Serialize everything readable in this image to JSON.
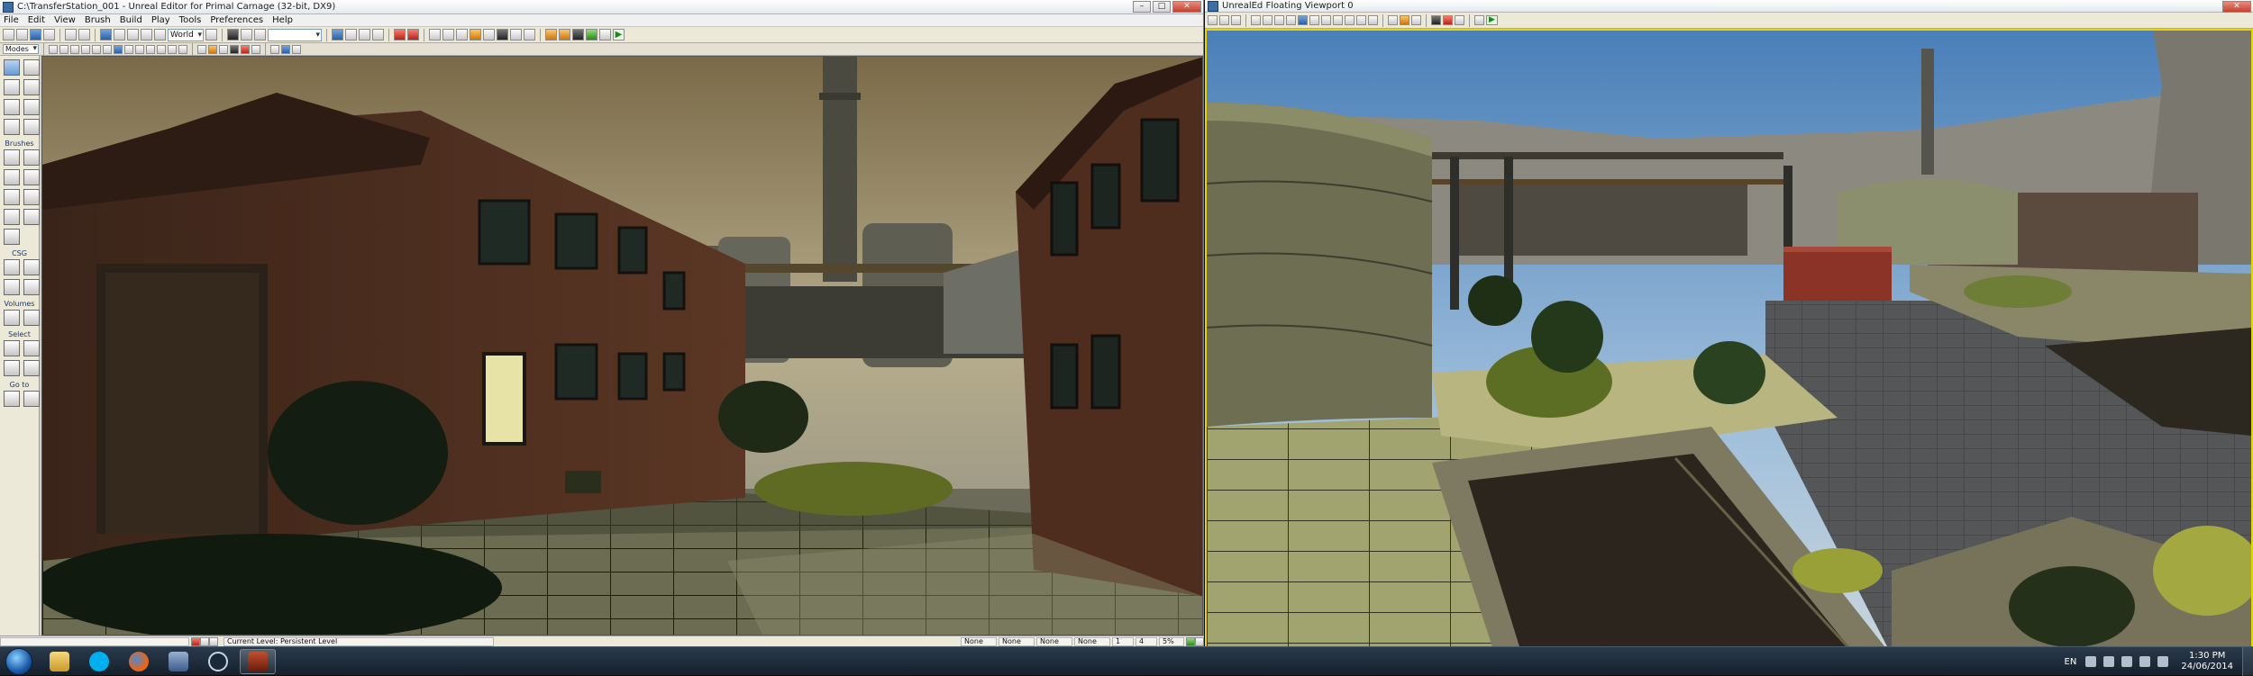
{
  "editor": {
    "title": "C:\\TransferStation_001 - Unreal Editor for Primal Carnage (32-bit, DX9)",
    "window_controls": [
      "–",
      "□",
      "✕"
    ],
    "menu": [
      "File",
      "Edit",
      "View",
      "Brush",
      "Build",
      "Play",
      "Tools",
      "Preferences",
      "Help"
    ],
    "toolbar": {
      "coordinate_system": "World",
      "modes_label": "Modes"
    },
    "modes_panel": {
      "sections": [
        "Brushes",
        "CSG",
        "Volumes",
        "Select",
        "Go to"
      ]
    },
    "status": {
      "current_level": "Current Level:  Persistent Level",
      "fields": [
        "None",
        "None",
        "None",
        "None"
      ],
      "grid": "1",
      "rotation": "4",
      "scale": "5%"
    }
  },
  "floating": {
    "title": "UnrealEd Floating Viewport 0"
  },
  "taskbar": {
    "language": "EN",
    "time": "1:30 PM",
    "date": "24/06/2014"
  },
  "colors": {
    "highlight_border": "#e8d400",
    "taskbar": "#1b2733"
  }
}
